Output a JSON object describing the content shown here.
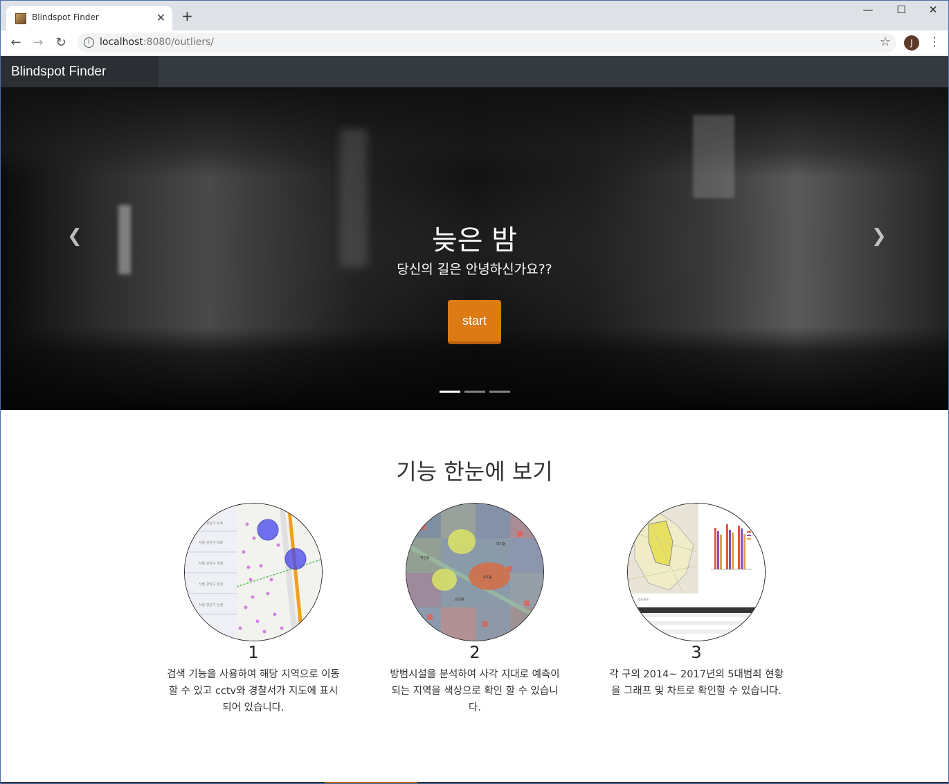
{
  "browser": {
    "tab_title": "Blindspot Finder",
    "tab_close": "✕",
    "new_tab": "+",
    "url_host": "localhost",
    "url_rest": ":8080/outliers/",
    "profile_initial": "J",
    "window_controls": {
      "minimize": "—",
      "maximize": "☐",
      "close": "✕"
    }
  },
  "nav": {
    "brand": "Blindspot Finder"
  },
  "hero": {
    "title": "늦은 밤",
    "subtitle": "당신의 길은 안녕하신가요??",
    "button": "start",
    "slides": 3,
    "active_slide": 1
  },
  "features": {
    "title": "기능 한눈에 보기",
    "items": [
      {
        "number": "1",
        "description": "검색 기능을 사용하여 해당 지역으로 이동할 수 있고 cctv와 경찰서가 지도에 표시되어 있습니다."
      },
      {
        "number": "2",
        "description": "방범시설을 분석하여 사각 지대로 예측이 되는 지역을 색상으로 확인 할 수 있습니다."
      },
      {
        "number": "3",
        "description": "각 구의 2014~ 2017년의 5대범죄 현황을 그래프 및 차트로 확인할 수 있습니다."
      }
    ]
  },
  "colors": {
    "accent": "#dc7a14",
    "navbar": "#343a40",
    "brand_bg": "#2b2f33"
  }
}
